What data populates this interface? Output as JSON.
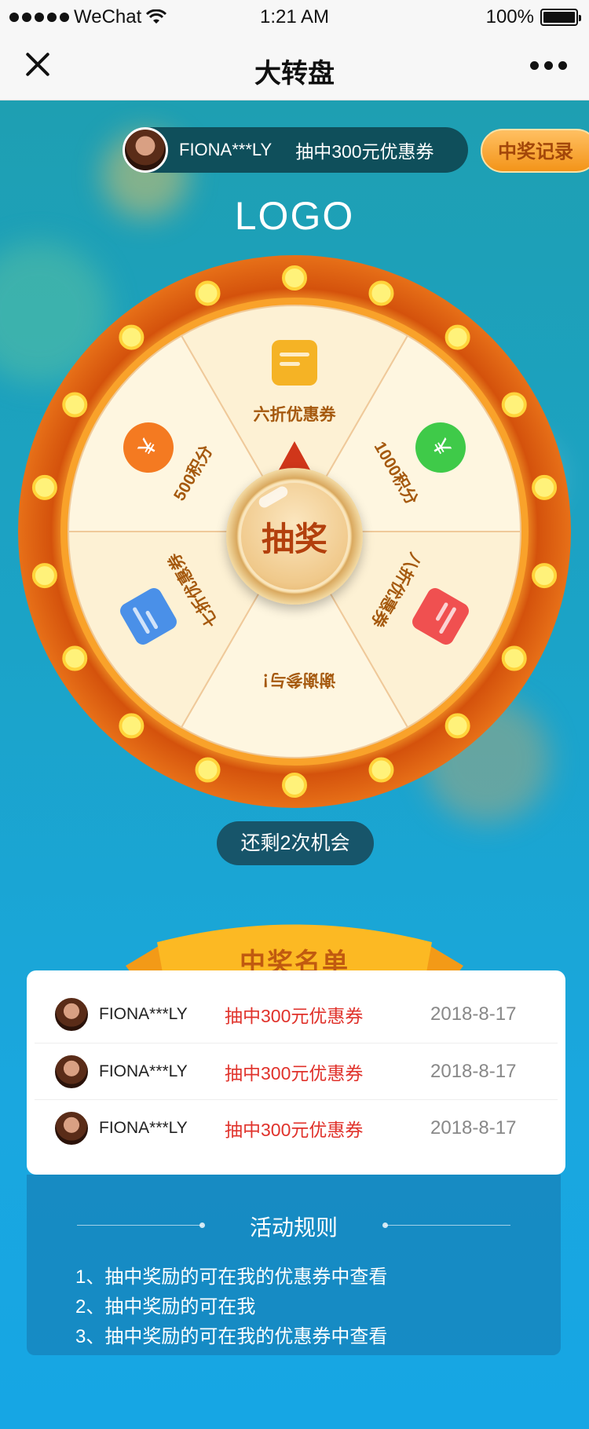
{
  "status_bar": {
    "carrier": "WeChat",
    "time": "1:21 AM",
    "battery": "100%"
  },
  "nav": {
    "title": "大转盘",
    "close_icon": "close-icon",
    "more_icon": "more-icon"
  },
  "ticker": {
    "name": "FIONA***LY",
    "prize": "抽中300元优惠券"
  },
  "record_button": "中奖记录",
  "logo": "LOGO",
  "wheel": {
    "segments": [
      {
        "label": "六折优惠券",
        "icon": "coupon-icon",
        "color": "#f5b325"
      },
      {
        "label": "1000积分",
        "icon": "coin-icon",
        "color": "#3fca49"
      },
      {
        "label": "八折优惠券",
        "icon": "coupon-icon",
        "color": "#f05050"
      },
      {
        "label": "谢谢参与！",
        "icon": "",
        "color": ""
      },
      {
        "label": "七折优惠券",
        "icon": "coupon-icon",
        "color": "#4a90e8"
      },
      {
        "label": "500积分",
        "icon": "coin-icon",
        "color": "#f47a21"
      }
    ],
    "spin_button": "抽奖",
    "coin_symbol": "¥"
  },
  "chances": "还剩2次机会",
  "winners": {
    "title": "中奖名单",
    "rows": [
      {
        "name": "FIONA***LY",
        "prize": "抽中300元优惠券",
        "date": "2018-8-17"
      },
      {
        "name": "FIONA***LY",
        "prize": "抽中300元优惠券",
        "date": "2018-8-17"
      },
      {
        "name": "FIONA***LY",
        "prize": "抽中300元优惠券",
        "date": "2018-8-17"
      }
    ]
  },
  "rules": {
    "title": "活动规则",
    "items": [
      "1、抽中奖励的可在我的优惠券中查看",
      "2、抽中奖励的可在我",
      "3、抽中奖励的可在我的优惠券中查看"
    ]
  },
  "colors": {
    "accent_orange": "#f39419",
    "prize_red": "#e0322b",
    "wheel_rim": "#e0620f"
  }
}
